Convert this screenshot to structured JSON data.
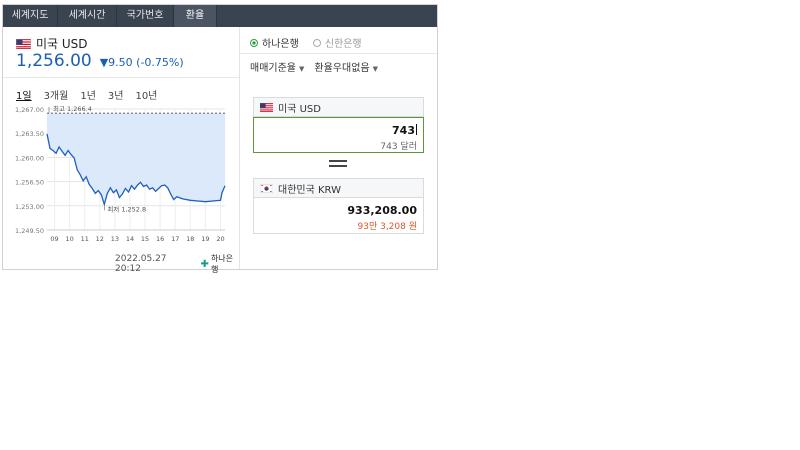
{
  "tabs": [
    {
      "label": "세계지도",
      "active": false
    },
    {
      "label": "세계시간",
      "active": false
    },
    {
      "label": "국가번호",
      "active": false
    },
    {
      "label": "환율",
      "active": true
    }
  ],
  "currency": {
    "name": "미국 USD",
    "price": "1,256.00",
    "change": "▼9.50 (-0.75%)",
    "change_color": "#1a5fb4"
  },
  "periods": [
    {
      "label": "1일",
      "active": true
    },
    {
      "label": "3개월",
      "active": false
    },
    {
      "label": "1년",
      "active": false
    },
    {
      "label": "3년",
      "active": false
    },
    {
      "label": "10년",
      "active": false
    }
  ],
  "chart_data": {
    "type": "area",
    "x_ticks": [
      "09",
      "10",
      "11",
      "12",
      "13",
      "14",
      "15",
      "16",
      "17",
      "18",
      "19",
      "20"
    ],
    "y_ticks": [
      "1,267.00",
      "1,263.50",
      "1,260.00",
      "1,256.50",
      "1,253.00",
      "1,249.50"
    ],
    "ylim": [
      1249.5,
      1267.0
    ],
    "xlim": [
      8.5,
      20.3
    ],
    "annotations": {
      "high": "최고 1,266.4",
      "low": "최저 1,252.8"
    },
    "high_value": 1266.4,
    "series": [
      {
        "points": [
          [
            8.5,
            1263.4
          ],
          [
            8.7,
            1261.3
          ],
          [
            8.9,
            1261.0
          ],
          [
            9.1,
            1260.6
          ],
          [
            9.3,
            1261.5
          ],
          [
            9.5,
            1260.9
          ],
          [
            9.7,
            1260.3
          ],
          [
            9.9,
            1261.0
          ],
          [
            10.1,
            1260.4
          ],
          [
            10.3,
            1259.9
          ],
          [
            10.5,
            1258.2
          ],
          [
            10.7,
            1257.5
          ],
          [
            10.9,
            1256.6
          ],
          [
            11.1,
            1257.2
          ],
          [
            11.3,
            1256.1
          ],
          [
            11.5,
            1255.5
          ],
          [
            11.7,
            1254.8
          ],
          [
            11.9,
            1255.2
          ],
          [
            12.1,
            1254.6
          ],
          [
            12.3,
            1253.2
          ],
          [
            12.5,
            1254.8
          ],
          [
            12.7,
            1255.6
          ],
          [
            12.9,
            1254.9
          ],
          [
            13.1,
            1255.3
          ],
          [
            13.3,
            1254.2
          ],
          [
            13.5,
            1254.7
          ],
          [
            13.7,
            1255.5
          ],
          [
            13.9,
            1255.0
          ],
          [
            14.1,
            1255.9
          ],
          [
            14.3,
            1255.4
          ],
          [
            14.5,
            1256.0
          ],
          [
            14.7,
            1256.4
          ],
          [
            14.9,
            1255.8
          ],
          [
            15.1,
            1256.0
          ],
          [
            15.3,
            1255.4
          ],
          [
            15.5,
            1255.6
          ],
          [
            15.7,
            1255.1
          ],
          [
            15.9,
            1255.5
          ],
          [
            16.1,
            1255.9
          ],
          [
            16.3,
            1256.0
          ],
          [
            16.5,
            1255.6
          ],
          [
            16.7,
            1254.7
          ],
          [
            16.9,
            1253.9
          ],
          [
            17.1,
            1254.3
          ],
          [
            17.5,
            1254.0
          ],
          [
            18.0,
            1253.8
          ],
          [
            18.5,
            1253.7
          ],
          [
            19.0,
            1253.6
          ],
          [
            19.5,
            1253.7
          ],
          [
            20.0,
            1253.8
          ],
          [
            20.1,
            1254.9
          ],
          [
            20.3,
            1255.9
          ]
        ]
      }
    ],
    "line_color": "#1f5fbf",
    "fill_color": "#dbe9fb"
  },
  "footer": {
    "timestamp": "2022.05.27 20:12",
    "bank_label": "하나은행"
  },
  "banks": [
    {
      "label": "하나은행",
      "selected": true
    },
    {
      "label": "신한은행",
      "selected": false
    }
  ],
  "selects": [
    {
      "label": "매매기준율"
    },
    {
      "label": "환율우대없음"
    }
  ],
  "converter": {
    "from_label": "미국 USD",
    "from_amount": "743",
    "from_amount_text": "743 달러",
    "to_label": "대한민국 KRW",
    "to_amount": "933,208.00",
    "to_amount_text": "93만 3,208 원"
  }
}
